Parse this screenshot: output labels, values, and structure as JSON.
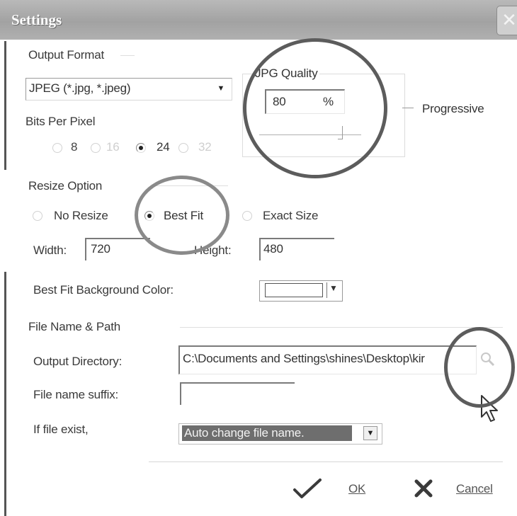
{
  "window": {
    "title": "Settings",
    "close_glyph": "✕"
  },
  "output_format": {
    "group_label": "Output Format",
    "format_value": "JPEG (*.jpg, *.jpeg)",
    "bits_label": "Bits Per Pixel",
    "bits_options": [
      "8",
      "16",
      "24",
      "32"
    ],
    "bits_selected": "24"
  },
  "jpg": {
    "group_label": "JPG Quality",
    "quality_value": "80",
    "unit": "%",
    "slider_level": 0.8,
    "progressive_label": "Progressive"
  },
  "resize": {
    "group_label": "Resize Option",
    "options": [
      "No Resize",
      "Best Fit",
      "Exact Size"
    ],
    "selected": "Best Fit",
    "width_label": "Width:",
    "width_value": "720",
    "height_label": "Height:",
    "height_value": "480",
    "bg_color_label": "Best Fit Background Color:"
  },
  "file": {
    "group_label": "File Name & Path",
    "output_dir_label": "Output Directory:",
    "output_dir_value": "C:\\Documents and Settings\\shines\\Desktop\\kir",
    "suffix_label": "File name suffix:",
    "suffix_value": "",
    "exist_label": "If file exist,",
    "exist_value": "Auto change file name."
  },
  "buttons": {
    "ok_label": "OK",
    "cancel_label": "Cancel"
  }
}
